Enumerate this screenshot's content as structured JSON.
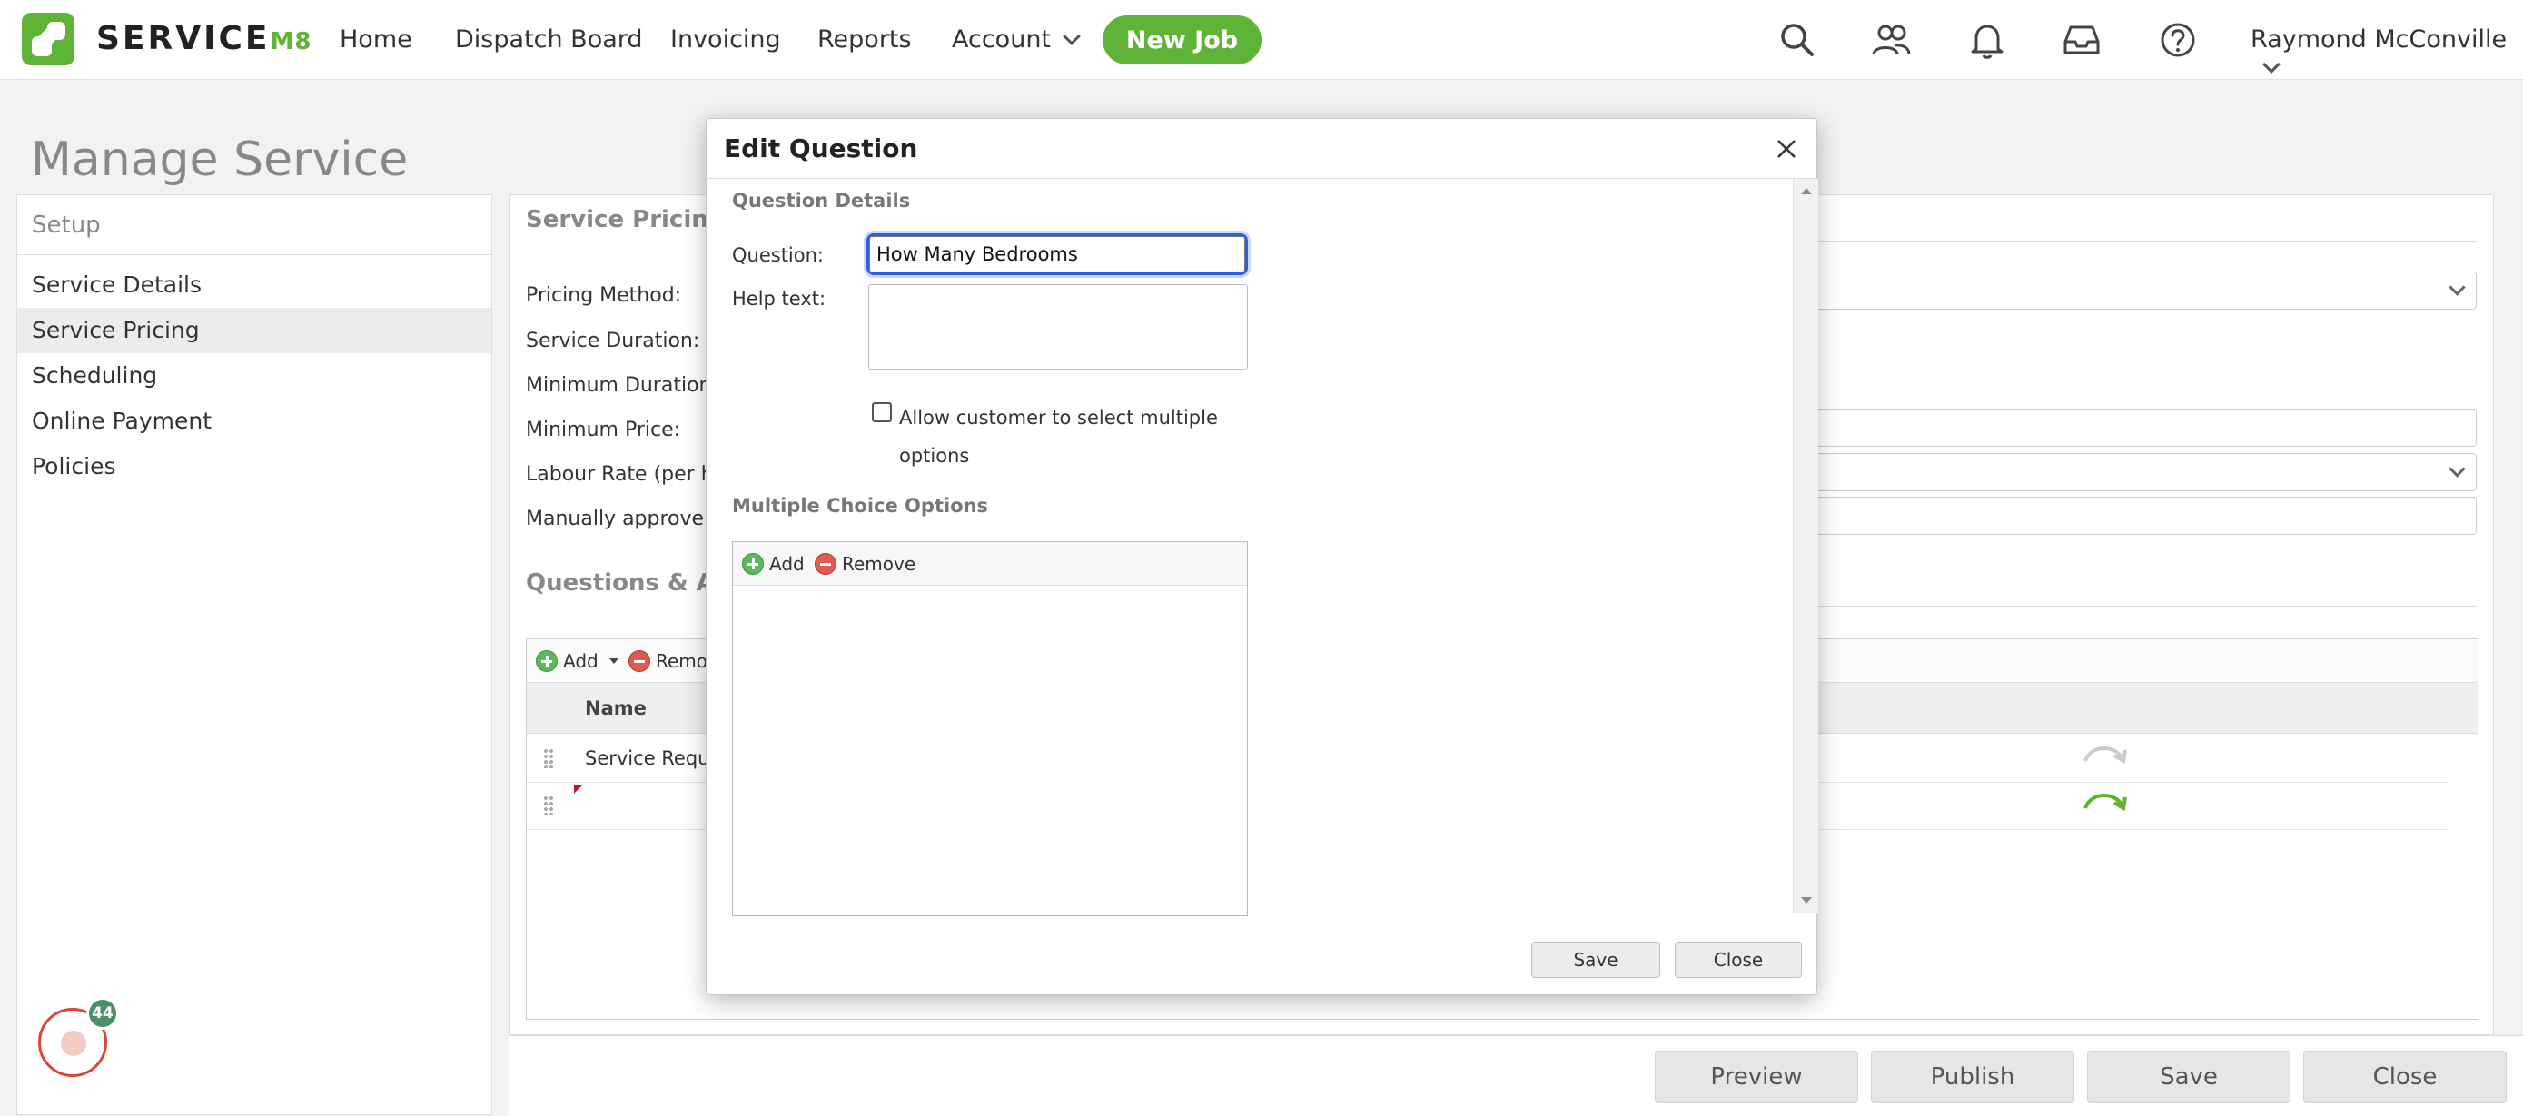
{
  "topnav": {
    "brand": "SERVICE",
    "brand_suffix": "M8",
    "items": [
      {
        "label": "Home"
      },
      {
        "label": "Dispatch Board"
      },
      {
        "label": "Invoicing"
      },
      {
        "label": "Reports"
      },
      {
        "label": "Account"
      }
    ],
    "new_job_label": "New Job",
    "user_name": "Raymond McConville",
    "icons": [
      "search-icon",
      "people-icon",
      "bell-icon",
      "inbox-icon",
      "help-icon"
    ]
  },
  "page": {
    "title": "Manage Service"
  },
  "sidebar": {
    "heading": "Setup",
    "items": [
      {
        "label": "Service Details"
      },
      {
        "label": "Service Pricing",
        "active": true
      },
      {
        "label": "Scheduling"
      },
      {
        "label": "Online Payment"
      },
      {
        "label": "Policies"
      }
    ]
  },
  "main": {
    "section_title": "Service Pricing",
    "fields": [
      {
        "label": "Pricing Method:"
      },
      {
        "label": "Service Duration:"
      },
      {
        "label": "Minimum Duration:"
      },
      {
        "label": "Minimum Price:"
      },
      {
        "label": "Labour Rate (per hou"
      },
      {
        "label": "Manually approve jo"
      }
    ],
    "questions_title": "Questions & Acti",
    "grid": {
      "add_label": "Add",
      "remove_label": "Remo",
      "column_name": "Name",
      "rows": [
        {
          "name": "Service Requi"
        },
        {
          "name": ""
        }
      ]
    }
  },
  "actions": {
    "preview": "Preview",
    "publish": "Publish",
    "save": "Save",
    "close": "Close"
  },
  "chat": {
    "badge_count": "44"
  },
  "modal": {
    "title": "Edit Question",
    "question_details_heading": "Question Details",
    "question_label": "Question:",
    "question_value": "How Many Bedrooms",
    "help_text_label": "Help text:",
    "help_text_value": "",
    "allow_multiple_label": "Allow customer to select multiple options",
    "allow_multiple_checked": false,
    "options_heading": "Multiple Choice Options",
    "options_add_label": "Add",
    "options_remove_label": "Remove",
    "save_label": "Save",
    "close_label": "Close"
  },
  "colors": {
    "brand_green": "#5fb336",
    "focus_blue": "#2f5fe0",
    "remove_red": "#e05a4f"
  }
}
